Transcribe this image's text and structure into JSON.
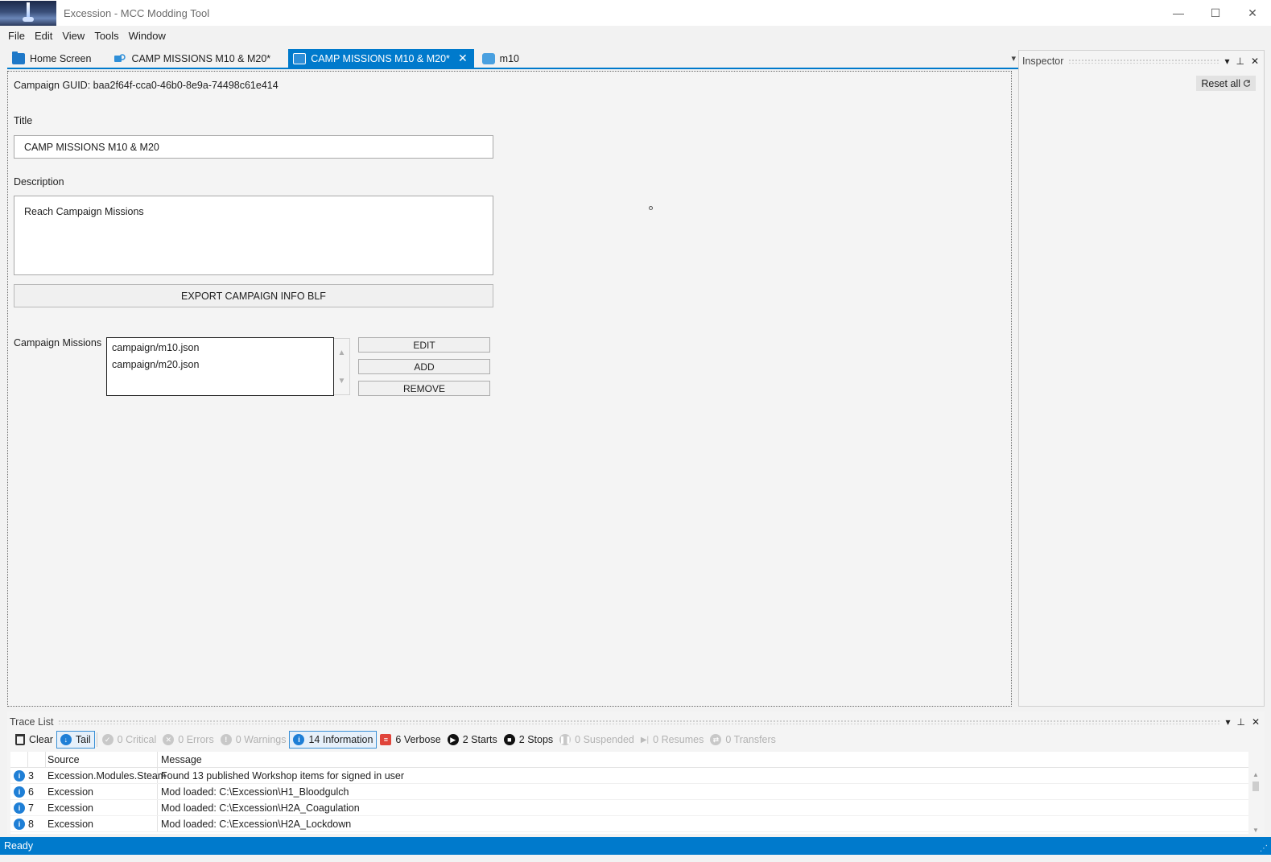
{
  "window": {
    "title": "Excession - MCC Modding Tool",
    "controls": {
      "minimize": "—",
      "maximize": "☐",
      "close": "✕"
    }
  },
  "menu": [
    {
      "label": "File"
    },
    {
      "label": "Edit"
    },
    {
      "label": "View"
    },
    {
      "label": "Tools"
    },
    {
      "label": "Window"
    }
  ],
  "tabs": [
    {
      "label": "Home Screen",
      "icon": "folder-icon"
    },
    {
      "label": "CAMP MISSIONS M10 & M20*",
      "icon": "campaign-icon"
    },
    {
      "label": "CAMP MISSIONS M10 & M20*",
      "icon": "cube-icon",
      "active": true,
      "close": "✕"
    },
    {
      "label": "m10",
      "icon": "puzzle-icon"
    }
  ],
  "tab_overflow": "▾",
  "editor": {
    "guid_text": "Campaign GUID: baa2f64f-cca0-46b0-8e9a-74498c61e414",
    "title_label": "Title",
    "title_value": "CAMP MISSIONS M10 & M20",
    "description_label": "Description",
    "description_value": "Reach Campaign Missions",
    "export_button": "EXPORT CAMPAIGN INFO BLF",
    "missions_label": "Campaign Missions",
    "missions": [
      "campaign/m10.json",
      "campaign/m20.json"
    ],
    "up_arrow": "▲",
    "down_arrow": "▼",
    "edit_button": "EDIT",
    "add_button": "ADD",
    "remove_button": "REMOVE"
  },
  "inspector": {
    "title": "Inspector",
    "reset_all": "Reset all",
    "header_icons": {
      "dropdown": "▾",
      "pin": "⊥",
      "close": "✕"
    }
  },
  "trace": {
    "title": "Trace List",
    "toolbar": {
      "clear": "Clear",
      "tail": "Tail",
      "critical": "0 Critical",
      "errors": "0 Errors",
      "warnings": "0 Warnings",
      "information": "14 Information",
      "verbose": "6 Verbose",
      "starts": "2 Starts",
      "stops": "2 Stops",
      "suspended": "0 Suspended",
      "resumes": "0 Resumes",
      "transfers": "0 Transfers"
    },
    "columns": {
      "source": "Source",
      "message": "Message"
    },
    "rows": [
      {
        "id": "3",
        "source": "Excession.Modules.Steam",
        "message": "Found 13 published Workshop items for signed in user"
      },
      {
        "id": "6",
        "source": "Excession",
        "message": "Mod loaded: C:\\Excession\\H1_Bloodgulch"
      },
      {
        "id": "7",
        "source": "Excession",
        "message": "Mod loaded: C:\\Excession\\H2A_Coagulation"
      },
      {
        "id": "8",
        "source": "Excession",
        "message": "Mod loaded: C:\\Excession\\H2A_Lockdown"
      }
    ]
  },
  "status": {
    "text": "Ready"
  },
  "colors": {
    "accent": "#007acc",
    "info_icon": "#1f7fd6",
    "verbose_icon": "#e0443a"
  }
}
